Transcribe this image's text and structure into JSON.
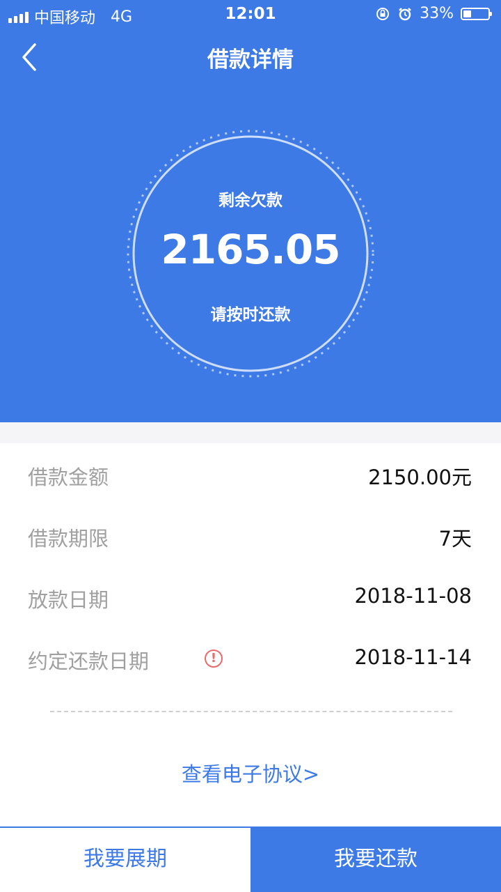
{
  "status_bar": {
    "carrier": "中国移动",
    "network": "4G",
    "time": "12:01",
    "battery": "33%"
  },
  "nav": {
    "title": "借款详情"
  },
  "summary": {
    "label": "剩余欠款",
    "amount": "2165.05",
    "hint": "请按时还款"
  },
  "details": [
    {
      "label": "借款金额",
      "value": "2150.00元"
    },
    {
      "label": "借款期限",
      "value": "7天"
    },
    {
      "label": "放款日期",
      "value": "2018-11-08"
    },
    {
      "label": "约定还款日期",
      "value": "2018-11-14"
    }
  ],
  "warning_glyph": "!",
  "agreement_link": "查看电子协议>",
  "actions": {
    "extend": "我要展期",
    "repay": "我要还款"
  },
  "colors": {
    "primary": "#3d7ae6",
    "label_gray": "#a0a0a0",
    "warning": "#e96a6a"
  }
}
